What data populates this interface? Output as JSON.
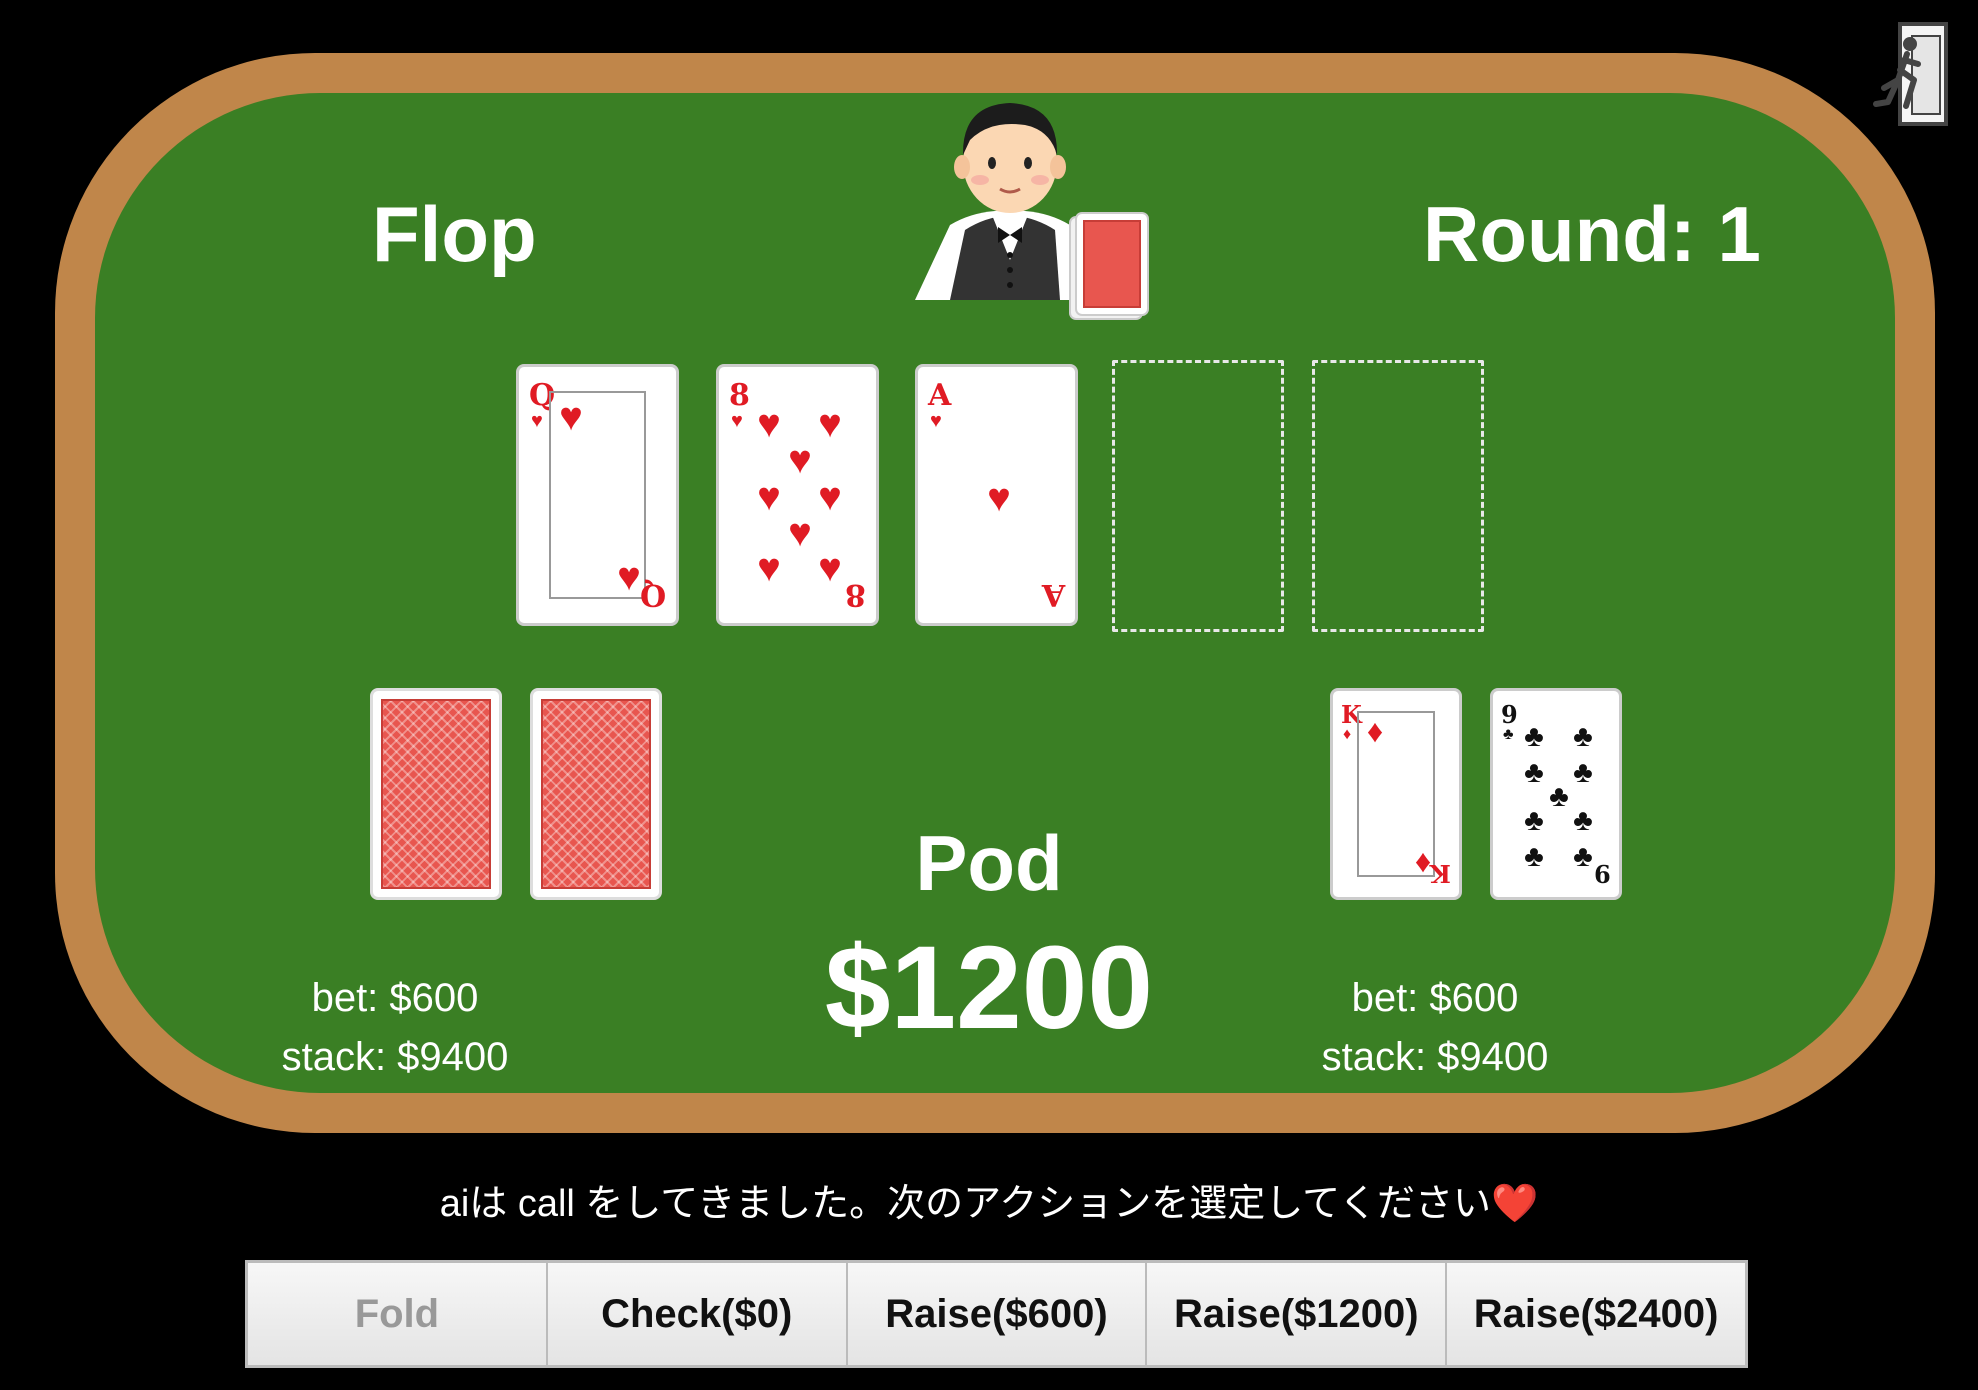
{
  "stage": "Flop",
  "round_label": "Round: 1",
  "pot": {
    "label": "Pod",
    "amount": "$1200"
  },
  "board": [
    {
      "rank": "Q",
      "suit": "♥",
      "color": "red",
      "face": "queen"
    },
    {
      "rank": "8",
      "suit": "♥",
      "color": "red",
      "face": "number"
    },
    {
      "rank": "A",
      "suit": "♥",
      "color": "red",
      "face": "ace"
    },
    {
      "empty": true
    },
    {
      "empty": true
    }
  ],
  "opponent": {
    "hand": [
      "back",
      "back"
    ],
    "bet": "bet: $600",
    "stack": "stack: $9400"
  },
  "player": {
    "hand": [
      {
        "rank": "K",
        "suit": "♦",
        "color": "red",
        "face": "king"
      },
      {
        "rank": "9",
        "suit": "♣",
        "color": "black",
        "face": "number"
      }
    ],
    "bet": "bet: $600",
    "stack": "stack: $9400"
  },
  "message": "aiは call をしてきました。次のアクションを選定してください",
  "message_emoji": "❤️",
  "actions": [
    {
      "label": "Fold",
      "enabled": false
    },
    {
      "label": "Check($0)",
      "enabled": true
    },
    {
      "label": "Raise($600)",
      "enabled": true
    },
    {
      "label": "Raise($1200)",
      "enabled": true
    },
    {
      "label": "Raise($2400)",
      "enabled": true
    }
  ],
  "icons": {
    "exit": "exit-door-icon",
    "dealer": "dealer-avatar-icon",
    "deck": "card-deck-icon"
  },
  "colors": {
    "felt": "#3a7f24",
    "rim": "#c0864a",
    "background": "#000000",
    "card_back": "#e8564f"
  }
}
